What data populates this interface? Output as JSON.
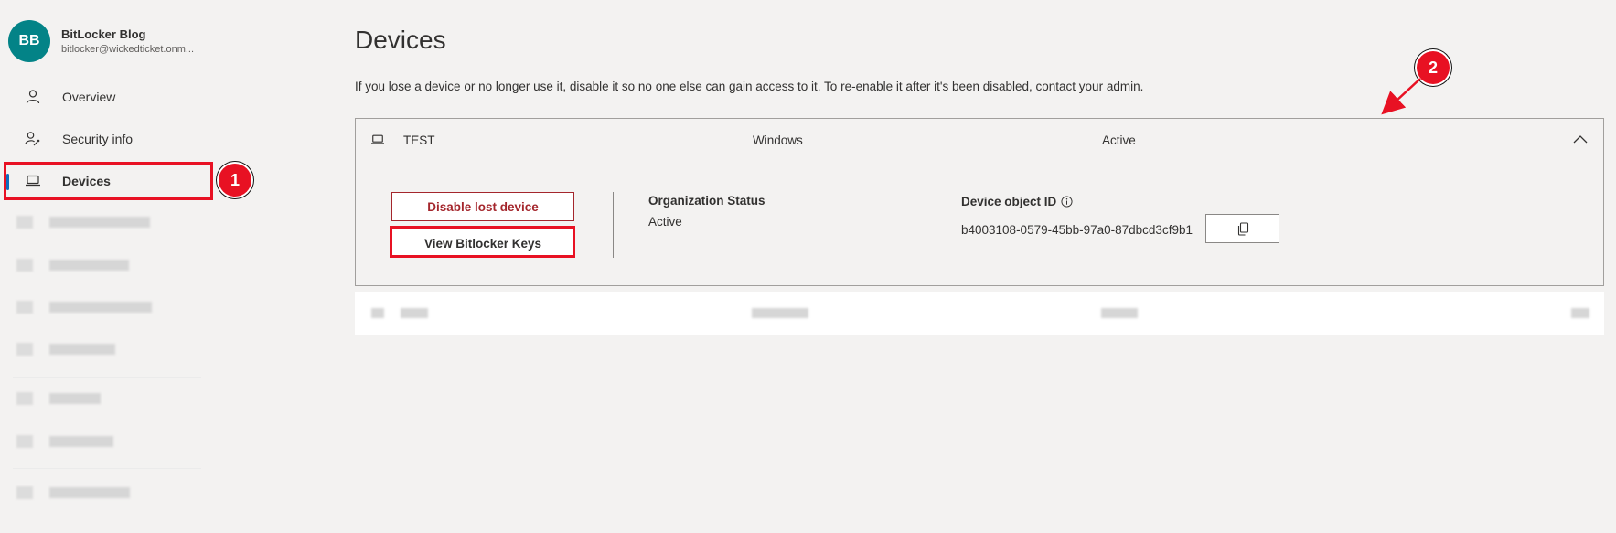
{
  "profile": {
    "initials": "BB",
    "name": "BitLocker Blog",
    "email": "bitlocker@wickedticket.onm..."
  },
  "sidebar": {
    "items": [
      {
        "label": "Overview",
        "icon": "person-icon"
      },
      {
        "label": "Security info",
        "icon": "person-key-icon"
      },
      {
        "label": "Devices",
        "icon": "laptop-icon",
        "active": true
      }
    ]
  },
  "main": {
    "title": "Devices",
    "description": "If you lose a device or no longer use it, disable it so no one else can gain access to it. To re-enable it after it's been disabled, contact your admin.",
    "device": {
      "name": "TEST",
      "os": "Windows",
      "status": "Active",
      "disable_label": "Disable lost device",
      "view_keys_label": "View Bitlocker Keys",
      "org_status_label": "Organization Status",
      "org_status_value": "Active",
      "object_id_label": "Device object ID",
      "object_id_value": "b4003108-0579-45bb-97a0-87dbcd3cf9b1"
    }
  },
  "annotations": {
    "badge1": "1",
    "badge2": "2"
  },
  "colors": {
    "accent": "#0f6cbd",
    "avatar": "#038387",
    "danger": "#a4262c",
    "annotation": "#e81123",
    "background": "#f3f2f1"
  }
}
